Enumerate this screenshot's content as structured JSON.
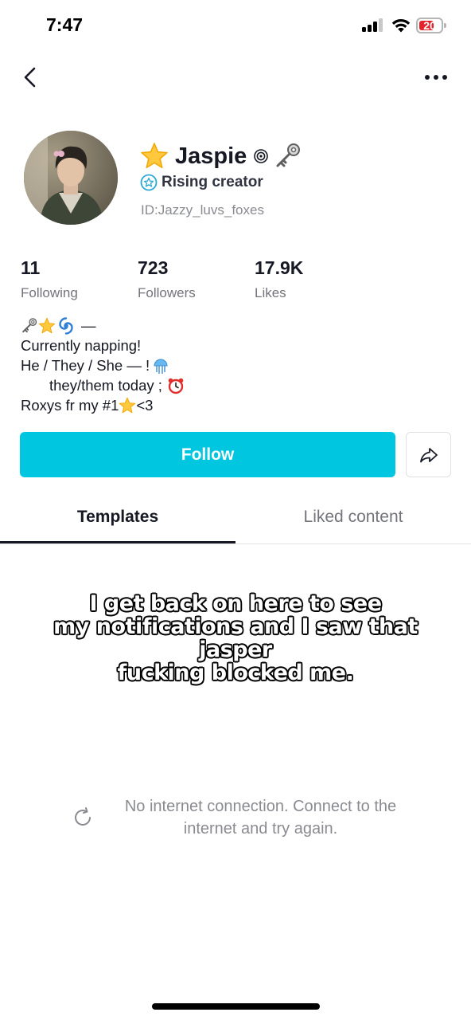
{
  "status_bar": {
    "time": "7:47",
    "battery_level": "20",
    "battery_color": "#e4242b"
  },
  "nav": {
    "back_icon": "chevron-left-icon",
    "more_icon": "ellipsis-icon"
  },
  "profile": {
    "avatar_icon": "avatar-photo",
    "name": "Jaspie",
    "name_emojis": [
      "star-emoji",
      "spiral-icon",
      "key-emoji"
    ],
    "badge_label": "Rising creator",
    "user_id": "ID:Jazzy_luvs_foxes"
  },
  "stats": [
    {
      "value": "11",
      "label": "Following"
    },
    {
      "value": "723",
      "label": "Followers"
    },
    {
      "value": "17.9K",
      "label": "Likes"
    }
  ],
  "bio": {
    "line1_text": "—",
    "line2": "Currently napping!",
    "line3": "He / They / She — !",
    "line4": "       they/them today ;",
    "line5_pre": "Roxys fr my #1",
    "line5_post": "<3"
  },
  "actions": {
    "follow_label": "Follow",
    "share_icon": "share-arrow-icon"
  },
  "tabs": [
    {
      "label": "Templates",
      "active": true
    },
    {
      "label": "Liked content",
      "active": false
    }
  ],
  "caption": {
    "line1": "I get back on here to see",
    "line2": "my notifications and I saw that jasper",
    "line3": "fucking blocked me."
  },
  "empty_state": {
    "icon": "reload-icon",
    "message": "No internet connection. Connect to the internet and try again."
  },
  "colors": {
    "accent": "#00c6e0",
    "text_primary": "#161823",
    "text_secondary": "#73747b"
  }
}
